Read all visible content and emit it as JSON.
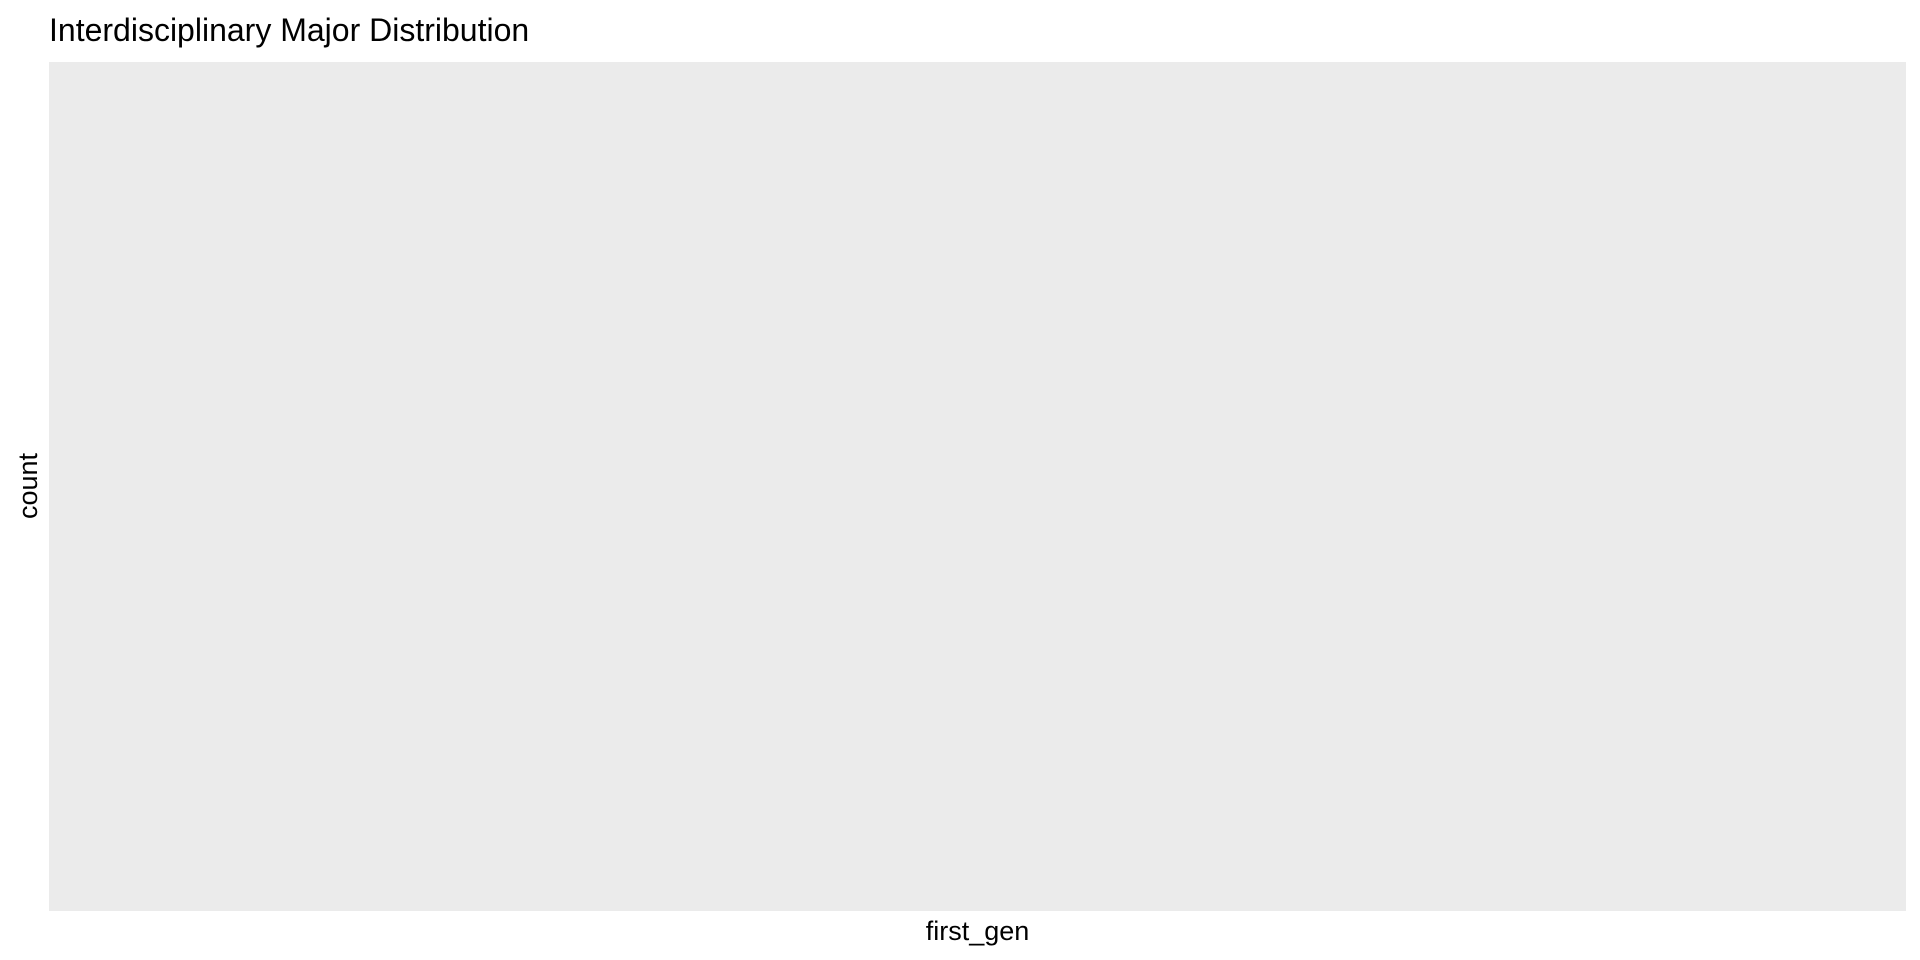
{
  "chart_data": {
    "type": "bar",
    "title": "Interdisciplinary Major Distribution",
    "xlabel": "first_gen",
    "ylabel": "count",
    "categories": [],
    "values": [],
    "grid": false,
    "legend": "none",
    "panel_background": "#ebebeb"
  }
}
